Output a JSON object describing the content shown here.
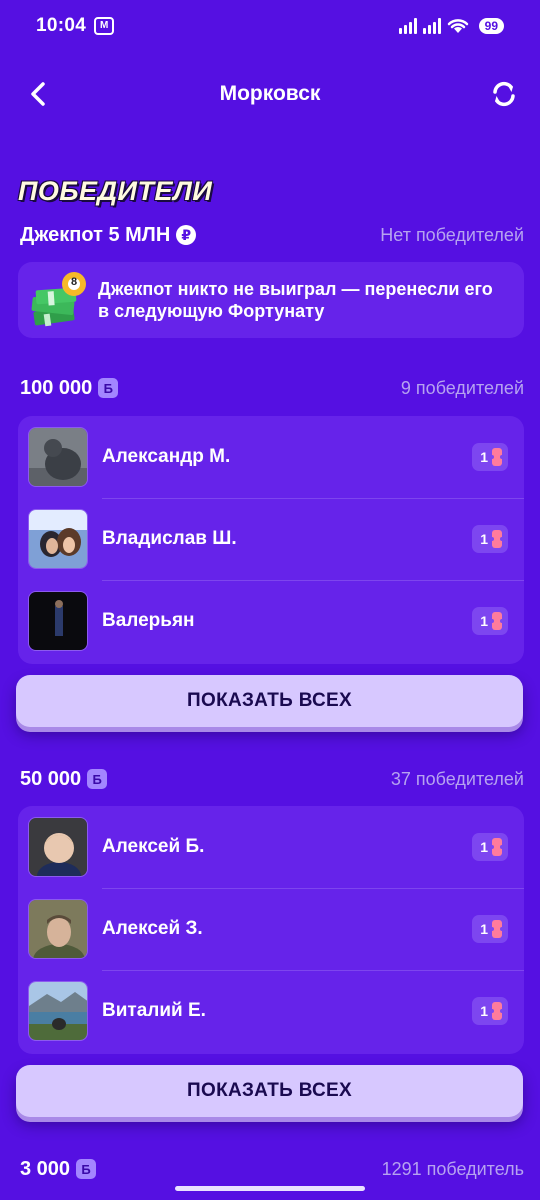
{
  "status_bar": {
    "time": "10:04",
    "mi_label": "M",
    "battery": "99"
  },
  "header": {
    "title": "Морковск",
    "back_icon": "chevron-left-icon",
    "refresh_icon": "refresh-icon"
  },
  "section_title": "ПОБЕДИТЕЛИ",
  "jackpot": {
    "label": "Джекпот 5 МЛН",
    "currency_symbol": "₽",
    "status": "Нет победителей",
    "message": "Джекпот никто не выиграл — перенесли его в следующую Фортунату",
    "ball_number": "8"
  },
  "prize_groups": [
    {
      "amount": "100 000",
      "badge": "Б",
      "winners_count": "9 победителей",
      "winners": [
        {
          "name": "Александр М.",
          "tickets": "1"
        },
        {
          "name": "Владислав Ш.",
          "tickets": "1"
        },
        {
          "name": "Валерьян",
          "tickets": "1"
        }
      ],
      "show_all_label": "ПОКАЗАТЬ ВСЕХ"
    },
    {
      "amount": "50 000",
      "badge": "Б",
      "winners_count": "37 победителей",
      "winners": [
        {
          "name": "Алексей Б.",
          "tickets": "1"
        },
        {
          "name": "Алексей З.",
          "tickets": "1"
        },
        {
          "name": "Виталий Е.",
          "tickets": "1"
        }
      ],
      "show_all_label": "ПОКАЗАТЬ ВСЕХ"
    },
    {
      "amount": "3 000",
      "badge": "Б",
      "winners_count": "1291 победитель"
    }
  ],
  "colors": {
    "background": "#5510e2",
    "card": "#6623ea",
    "button": "#d7c8ff",
    "ticket": "#ff7b9c"
  }
}
